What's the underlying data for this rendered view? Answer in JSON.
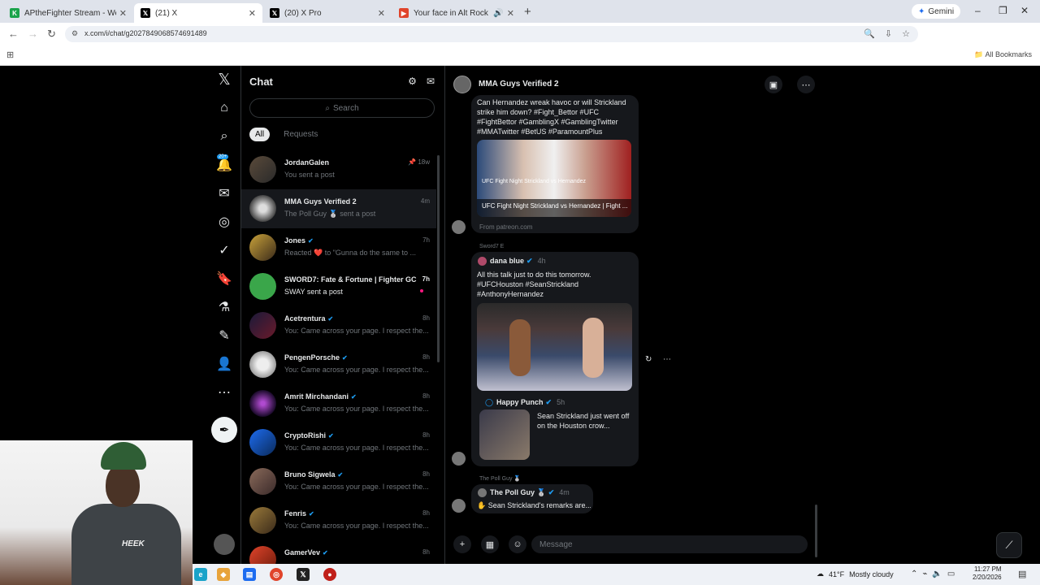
{
  "browser": {
    "tabs": [
      {
        "title": "APtheFighter Stream - We...",
        "close": "✕"
      },
      {
        "title": "(21) X",
        "close": "✕"
      },
      {
        "title": "(20) X Pro",
        "close": "✕"
      },
      {
        "title": "Your face in Alt Rock",
        "close": "✕"
      }
    ],
    "new_tab": "+",
    "gemini_label": "Gemini",
    "url": "x.com/i/chat/g2027849068574691489",
    "all_bookmarks": "All Bookmarks"
  },
  "nav": {
    "notifications_badge": "20+"
  },
  "chat": {
    "title": "Chat",
    "search_placeholder": "Search",
    "filter_all": "All",
    "filter_requests": "Requests",
    "conversations": [
      {
        "name": "JordanGalen",
        "time": "18w",
        "preview": "You sent a post",
        "verified": false
      },
      {
        "name": "MMA Guys Verified 2",
        "time": "4m",
        "preview": "The Poll Guy 🥈 sent a post",
        "verified": false
      },
      {
        "name": "Jones",
        "time": "7h",
        "preview": "Reacted ❤️ to \"Gunna do the same to ...",
        "verified": true
      },
      {
        "name": "SWORD7: Fate & Fortune | Fighter GC",
        "time": "7h",
        "preview": "SWAY sent a post",
        "verified": false
      },
      {
        "name": "Acetrentura",
        "time": "8h",
        "preview": "You: Came across your page. I respect the...",
        "verified": true
      },
      {
        "name": "PengenPorsche",
        "time": "8h",
        "preview": "You: Came across your page. I respect the...",
        "verified": true
      },
      {
        "name": "Amrit Mirchandani",
        "time": "8h",
        "preview": "You: Came across your page. I respect the...",
        "verified": true
      },
      {
        "name": "CryptoRishi",
        "time": "8h",
        "preview": "You: Came across your page. I respect the...",
        "verified": true
      },
      {
        "name": "Bruno Sigwela",
        "time": "8h",
        "preview": "You: Came across your page. I respect the...",
        "verified": true
      },
      {
        "name": "Fenris",
        "time": "8h",
        "preview": "You: Came across your page. I respect the...",
        "verified": true
      },
      {
        "name": "GamerVev",
        "time": "8h",
        "preview": "",
        "verified": true
      }
    ]
  },
  "conversation": {
    "title": "MMA Guys Verified 2",
    "msg1_text": "Can Hernandez wreak havoc or will Strickland strike him down? #Fight_Bettor #UFC #FightBettor #GamblingX #GamblingTwitter #MMATwitter #BetUS #ParamountPlus",
    "msg1_card_title": "UFC Fight Night Strickland vs Hernandez",
    "msg1_card_sub": "UFC Fight Night Strickland vs Hernandez | Fight ...",
    "msg1_card_source": "From patreon.com",
    "msg2_sender_label": "Sword7 E",
    "msg2_author": "dana blue",
    "msg2_time": "4h",
    "msg2_text": "All this talk just to do this tomorrow. #UFCHouston #SeanStrickland #AnthonyHernandez",
    "msg2_quote_author": "Happy Punch",
    "msg2_quote_time": "5h",
    "msg2_quote_text": "Sean Strickland just went off on the Houston crow...",
    "msg3_sender_label": "The Poll Guy 🥈",
    "msg3_author": "The Poll Guy 🥈",
    "msg3_time": "4m",
    "msg3_text": "Sean Strickland's remarks are...",
    "input_placeholder": "Message"
  },
  "webcam": {
    "shirt_logo": "HEEK"
  },
  "taskbar": {
    "weather_temp": "41°F",
    "weather_desc": "Mostly cloudy",
    "time": "11:27 PM",
    "date": "2/20/2026"
  },
  "colors": {
    "accent": "#1d9bf0",
    "background": "#000000",
    "panel": "#16181c"
  }
}
